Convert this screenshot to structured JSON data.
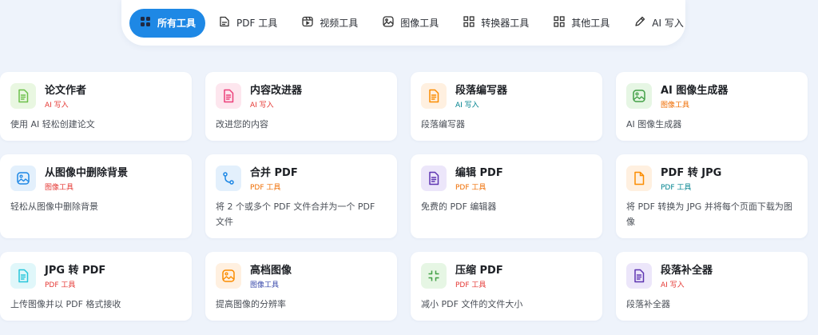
{
  "tabs": [
    {
      "label": "所有工具",
      "icon": "grid-icon",
      "active": true
    },
    {
      "label": "PDF 工具",
      "icon": "pdf-file-icon"
    },
    {
      "label": "视频工具",
      "icon": "video-icon"
    },
    {
      "label": "图像工具",
      "icon": "image-icon"
    },
    {
      "label": "转换器工具",
      "icon": "converter-grid-icon"
    },
    {
      "label": "其他工具",
      "icon": "other-grid-icon"
    },
    {
      "label": "AI 写入",
      "icon": "pencil-icon"
    }
  ],
  "cards": [
    {
      "title": "论文作者",
      "badge": "AI 写入",
      "desc": "使用 AI 轻松创建论文",
      "icon": "document-icon",
      "icon_color": "#6cc04a",
      "icon_bg": "#e9f7e1",
      "badge_color": "#e53935"
    },
    {
      "title": "内容改进器",
      "badge": "AI 写入",
      "desc": "改进您的内容",
      "icon": "document-icon",
      "icon_color": "#ec407a",
      "icon_bg": "#fde6ee",
      "badge_color": "#e53935"
    },
    {
      "title": "段落编写器",
      "badge": "AI 写入",
      "desc": "段落编写器",
      "icon": "document-icon",
      "icon_color": "#fb8c00",
      "icon_bg": "#fff0e0",
      "badge_color": "#00838f"
    },
    {
      "title": "AI 图像生成器",
      "badge": "图像工具",
      "desc": "AI 图像生成器",
      "icon": "image-icon",
      "icon_color": "#43a047",
      "icon_bg": "#e6f6e4",
      "badge_color": "#ef6c00"
    },
    {
      "title": "从图像中删除背景",
      "badge": "图像工具",
      "desc": "轻松从图像中删除背景",
      "icon": "image-icon",
      "icon_color": "#1e88e5",
      "icon_bg": "#e3f0fc",
      "badge_color": "#e53935"
    },
    {
      "title": "合并 PDF",
      "badge": "PDF 工具",
      "desc": "将 2 个或多个 PDF 文件合并为一个 PDF 文件",
      "icon": "merge-icon",
      "icon_color": "#1e88e5",
      "icon_bg": "#e3f0fc",
      "badge_color": "#ef6c00"
    },
    {
      "title": "编辑 PDF",
      "badge": "PDF 工具",
      "desc": "免费的 PDF 编辑器",
      "icon": "document-icon",
      "icon_color": "#5e35b1",
      "icon_bg": "#ece6fa",
      "badge_color": "#ef6c00"
    },
    {
      "title": "PDF 转 JPG",
      "badge": "PDF 工具",
      "desc": "将 PDF 转换为 JPG 并将每个页面下载为图像",
      "icon": "file-icon",
      "icon_color": "#fb8c00",
      "icon_bg": "#fff0e0",
      "badge_color": "#00838f"
    },
    {
      "title": "JPG 转 PDF",
      "badge": "PDF 工具",
      "desc": "上传图像并以 PDF 格式接收",
      "icon": "document-icon",
      "icon_color": "#26c6da",
      "icon_bg": "#e0f7fa",
      "badge_color": "#e53935"
    },
    {
      "title": "高档图像",
      "badge": "图像工具",
      "desc": "提高图像的分辨率",
      "icon": "image-icon",
      "icon_color": "#fb8c00",
      "icon_bg": "#fff0e0",
      "badge_color": "#3949ab"
    },
    {
      "title": "压缩 PDF",
      "badge": "PDF 工具",
      "desc": "减小 PDF 文件的文件大小",
      "icon": "compress-icon",
      "icon_color": "#43a047",
      "icon_bg": "#e6f6e4",
      "badge_color": "#e53935"
    },
    {
      "title": "段落补全器",
      "badge": "AI 写入",
      "desc": "段落补全器",
      "icon": "document-icon",
      "icon_color": "#5e35b1",
      "icon_bg": "#ece6fa",
      "badge_color": "#e53935"
    }
  ]
}
